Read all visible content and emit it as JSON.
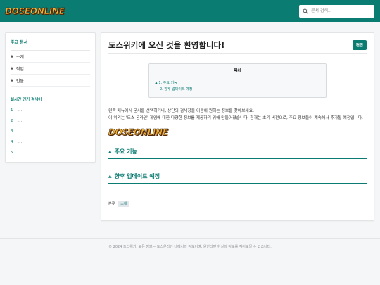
{
  "header": {
    "logo_text": "DOSEONLINE",
    "search_placeholder": "문서 검색..."
  },
  "sidebar": {
    "title": "주요 문서",
    "items": [
      {
        "label": "소개"
      },
      {
        "label": "직업"
      },
      {
        "label": "인물"
      }
    ],
    "popular_title": "실시간 인기 검색어",
    "popular": [
      {
        "num": "1",
        "text": "..."
      },
      {
        "num": "2",
        "text": "..."
      },
      {
        "num": "3",
        "text": "..."
      },
      {
        "num": "4",
        "text": "..."
      },
      {
        "num": "5",
        "text": "..."
      }
    ]
  },
  "main": {
    "title": "도스위키에 오신 것을 환영합니다!",
    "edit_label": "편집",
    "toc": {
      "title": "목차",
      "items": [
        {
          "label": "▲ 1. 주요 기능"
        },
        {
          "label": "2. 향후 업데이트 예정"
        }
      ]
    },
    "intro_line1": "왼쪽 메뉴에서 문서를 선택하거나, 상단의 검색창을 이용해 원하는 정보를 찾아보세요.",
    "intro_line2": "이 위키는 '도스 온라인' 게임에 대한 다양한 정보를 제공하기 위해 만들어졌습니다. 현재는 초기 버전으로, 주요 정보들이 계속해서 추가될 예정입니다.",
    "logo_text": "DOSEONLINE",
    "sections": [
      {
        "label": "주요 기능"
      },
      {
        "label": "향후 업데이트 예정"
      }
    ],
    "category_label": "분류",
    "category_tag": "소개"
  },
  "footer": {
    "text": "© 2024 도스위키. 모든 정보는 도스온라인 내에서의 정보이며, 원한다면 현실의 정보를 적어도될 수 있습니다."
  },
  "colors": {
    "accent": "#0b7c72",
    "logo": "#f3b23a"
  }
}
